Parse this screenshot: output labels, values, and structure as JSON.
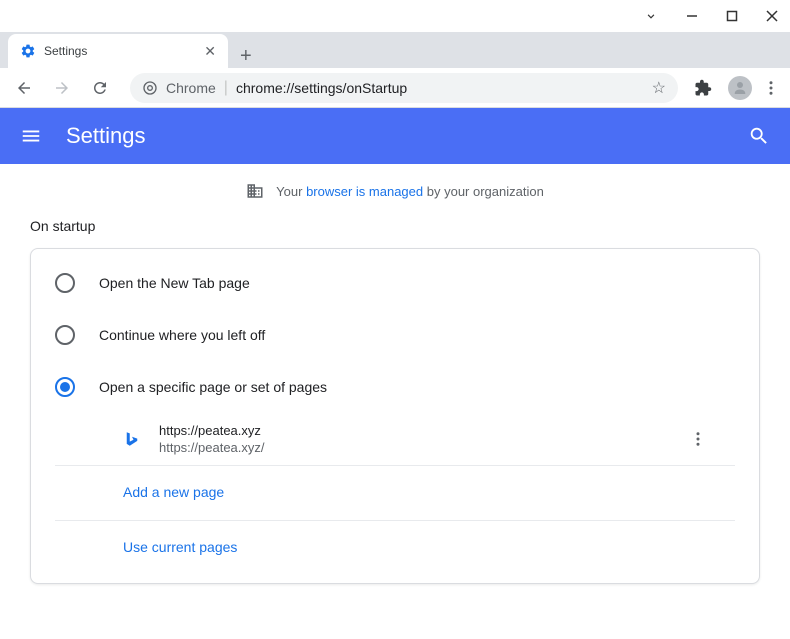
{
  "window": {
    "tab_title": "Settings"
  },
  "omnibox": {
    "prefix": "Chrome",
    "url": "chrome://settings/onStartup"
  },
  "header": {
    "title": "Settings"
  },
  "banner": {
    "prefix": "Your",
    "link": "browser is managed",
    "suffix": "by your organization"
  },
  "section": {
    "title": "On startup"
  },
  "options": {
    "new_tab": "Open the New Tab page",
    "continue": "Continue where you left off",
    "specific": "Open a specific page or set of pages"
  },
  "page": {
    "name": "https://peatea.xyz",
    "url": "https://peatea.xyz/"
  },
  "actions": {
    "add": "Add a new page",
    "current": "Use current pages"
  }
}
